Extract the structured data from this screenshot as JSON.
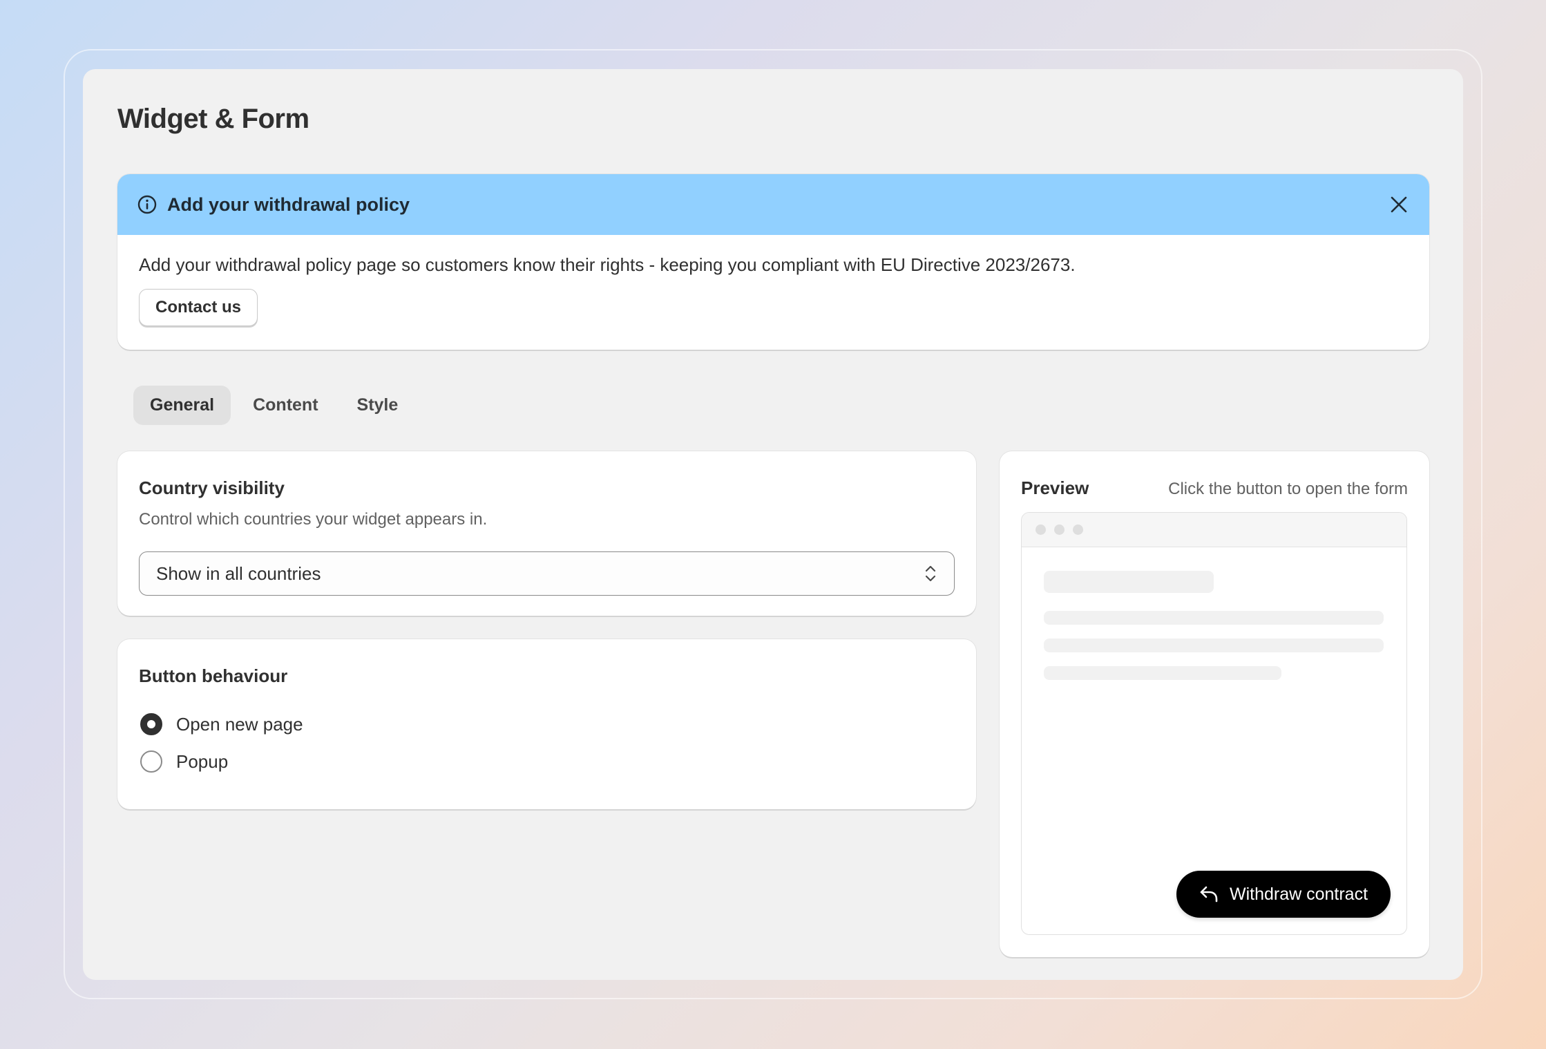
{
  "page": {
    "title": "Widget & Form"
  },
  "banner": {
    "icon": "info-icon",
    "title": "Add your withdrawal policy",
    "text": "Add your withdrawal policy page so customers know their rights - keeping you compliant with EU Directive 2023/2673.",
    "contact_label": "Contact us",
    "close_icon": "close-icon",
    "header_color": "#91d0ff"
  },
  "tabs": [
    {
      "label": "General",
      "active": true
    },
    {
      "label": "Content",
      "active": false
    },
    {
      "label": "Style",
      "active": false
    }
  ],
  "country_visibility": {
    "title": "Country visibility",
    "description": "Control which countries your widget appears in.",
    "selected": "Show in all countries"
  },
  "button_behaviour": {
    "title": "Button behaviour",
    "options": [
      {
        "label": "Open new page",
        "checked": true
      },
      {
        "label": "Popup",
        "checked": false
      }
    ]
  },
  "preview": {
    "title": "Preview",
    "hint": "Click the button to open the form",
    "button_label": "Withdraw contract",
    "button_icon": "reply-arrow-icon"
  }
}
